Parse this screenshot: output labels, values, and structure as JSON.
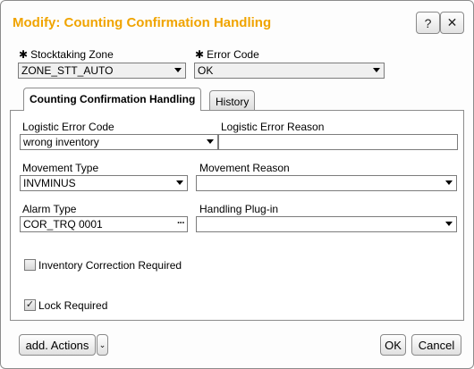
{
  "dialog": {
    "title": "Modify: Counting Confirmation Handling",
    "help_label": "?",
    "close_label": "✕"
  },
  "header_fields": {
    "required_mark": "✱",
    "stocktaking_zone": {
      "label": "Stocktaking Zone",
      "value": "ZONE_STT_AUTO"
    },
    "error_code": {
      "label": "Error Code",
      "value": "OK"
    }
  },
  "tabs": [
    {
      "label": "Counting Confirmation Handling",
      "active": true
    },
    {
      "label": "History",
      "active": false
    }
  ],
  "form": {
    "logistic_error_code": {
      "label": "Logistic Error Code",
      "value": "wrong inventory"
    },
    "logistic_error_reason": {
      "label": "Logistic Error Reason",
      "value": ""
    },
    "movement_type": {
      "label": "Movement Type",
      "value": "INVMINUS"
    },
    "movement_reason": {
      "label": "Movement Reason",
      "value": ""
    },
    "alarm_type": {
      "label": "Alarm Type",
      "value": "COR_TRQ 0001"
    },
    "handling_plugin": {
      "label": "Handling Plug-in",
      "value": ""
    },
    "inventory_correction": {
      "label": "Inventory Correction Required",
      "checked": false
    },
    "lock_required": {
      "label": "Lock Required",
      "checked": true
    }
  },
  "footer": {
    "add_actions_label": "add. Actions",
    "ok_label": "OK",
    "cancel_label": "Cancel"
  }
}
